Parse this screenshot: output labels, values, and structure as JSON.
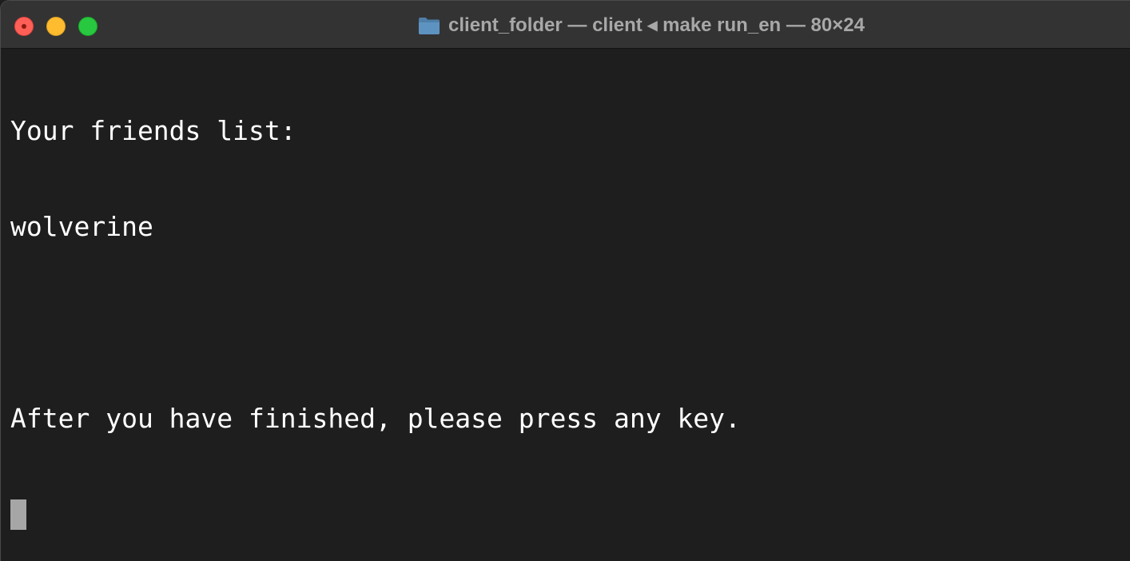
{
  "window": {
    "title": "client_folder — client ◂ make run_en — 80×24",
    "traffic_lights": {
      "close_color": "#fe5f57",
      "minimize_color": "#febc2e",
      "maximize_color": "#28c840"
    },
    "folder_icon": "folder-icon"
  },
  "terminal": {
    "background": "#1e1e1e",
    "foreground": "#ffffff",
    "lines": [
      "Your friends list:",
      "wolverine",
      "",
      "After you have finished, please press any key."
    ]
  }
}
